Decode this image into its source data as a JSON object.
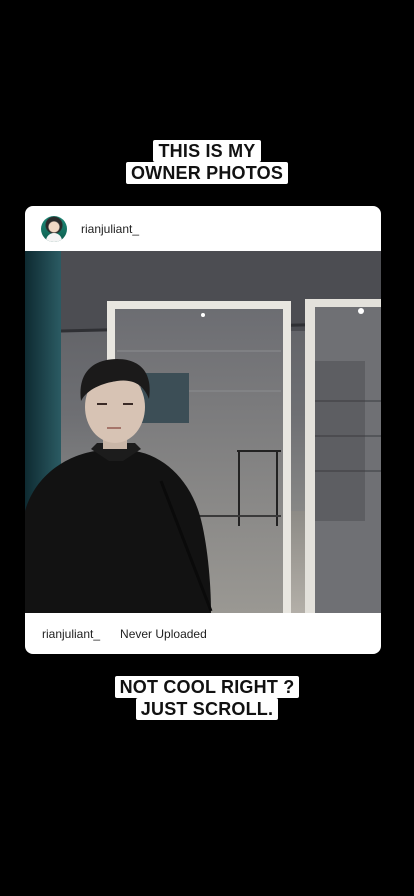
{
  "top_caption": {
    "line1": "THIS IS MY",
    "line2": "OWNER PHOTOS"
  },
  "post": {
    "username": "rianjuliant_",
    "footer_username": "rianjuliant_",
    "footer_status": "Never Uploaded",
    "avatar_icon": "profile-avatar-icon"
  },
  "bottom_caption": {
    "line1": "NOT COOL RIGHT ?",
    "line2": "JUST SCROLL."
  },
  "colors": {
    "background": "#000000",
    "card": "#ffffff",
    "sticker": "#ffffff",
    "text": "#111111"
  }
}
